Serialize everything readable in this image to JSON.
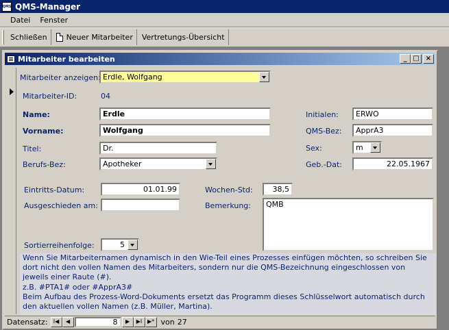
{
  "app": {
    "title": "QMS-Manager",
    "icon_text": "QMS"
  },
  "menu": [
    "Datei",
    "Fenster"
  ],
  "toolbar": {
    "close_label": "Schließen",
    "new_employee_label": "Neuer Mitarbeiter",
    "substitute_overview_label": "Vertretungs-Übersicht"
  },
  "window": {
    "title": "Mitarbeiter bearbeiten",
    "minimize": "_",
    "maximize": "□",
    "close": "×"
  },
  "form": {
    "show_label": "Mitarbeiter anzeigen:",
    "show_value": "Erdle, Wolfgang",
    "id_label": "Mitarbeiter-ID:",
    "id_value": "04",
    "name_label": "Name:",
    "name_value": "Erdle",
    "firstname_label": "Vorname:",
    "firstname_value": "Wolfgang",
    "title_label": "Titel:",
    "title_value": "Dr.",
    "profession_label": "Berufs-Bez:",
    "profession_value": "Apotheker",
    "initials_label": "Initialen:",
    "initials_value": "ERWO",
    "qms_label": "QMS-Bez:",
    "qms_value": "ApprA3",
    "sex_label": "Sex:",
    "sex_value": "m",
    "birth_label": "Geb.-Dat:",
    "birth_value": "22.05.1967",
    "entry_label": "Eintritts-Datum:",
    "entry_value": "01.01.99",
    "left_label": "Ausgeschieden am:",
    "left_value": "",
    "hours_label": "Wochen-Std:",
    "hours_value": "38,5",
    "remark_label": "Bemerkung:",
    "remark_value": "QMB",
    "sort_label": "Sortierreihenfolge:",
    "sort_value": "5"
  },
  "note": {
    "line1": "Wenn Sie Mitarbeiternamen dynamisch in den Wie-Teil eines Prozesses einfügen möchten, so schreiben Sie dort nicht den vollen Namen des Mitarbeiters, sondern nur die QMS-Bezeichnung eingeschlossen von jeweils einer Raute (#).",
    "line2": "z.B. #PTA1# oder #ApprA3#",
    "line3": "Beim Aufbau des Prozess-Word-Dokuments ersetzt das Programm dieses Schlüsselwort automatisch durch den aktuellen vollen Namen (z.B. Müller, Martina)."
  },
  "nav": {
    "label": "Datensatz:",
    "current": "8",
    "of_label": "von",
    "total": "27",
    "first": "I◀",
    "prev": "◀",
    "next": "▶",
    "last": "▶I",
    "new": "▶*"
  }
}
